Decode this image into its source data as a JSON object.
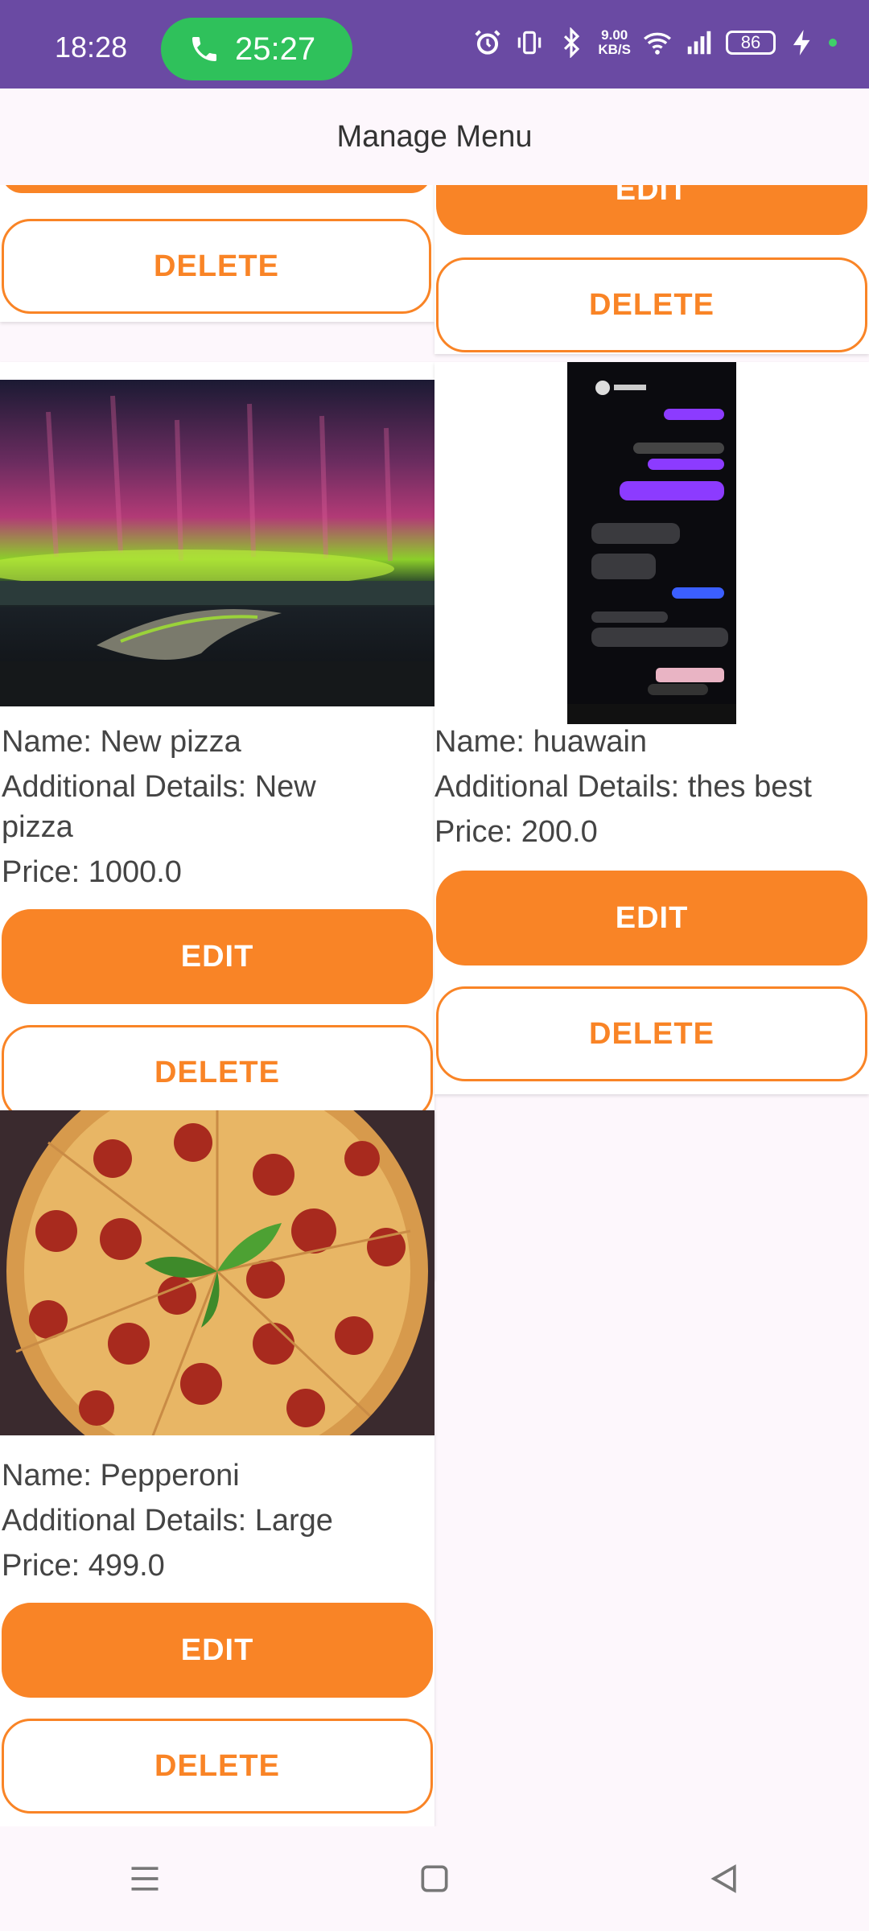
{
  "status_bar": {
    "time": "18:28",
    "call_duration": "25:27",
    "net_speed_value": "9.00",
    "net_speed_unit": "KB/S",
    "battery": "86"
  },
  "app_bar": {
    "title": "Manage Menu"
  },
  "top_partial": {
    "left_delete": "DELETE",
    "right_edit": "EDIT",
    "right_delete": "DELETE"
  },
  "items": [
    {
      "name": "Name: New pizza",
      "details_line1": "Additional Details: New",
      "details_line2": "pizza",
      "price": "Price: 1000.0",
      "edit_label": "EDIT",
      "delete_label": "DELETE",
      "image": "aurora-photo"
    },
    {
      "name": "Name: huawain",
      "details_line1": "Additional Details: thes best",
      "price": "Price: 200.0",
      "edit_label": "EDIT",
      "delete_label": "DELETE",
      "image": "chat-screenshot"
    },
    {
      "name": "Name: Pepperoni",
      "details_line1": "Additional Details: Large",
      "price": "Price: 499.0",
      "edit_label": "EDIT",
      "delete_label": "DELETE",
      "image": "pepperoni-pizza-photo"
    }
  ],
  "colors": {
    "accent": "#f98426",
    "status_bar": "#6a4aa3",
    "call_green": "#2fc15b"
  },
  "nav": {
    "icons": [
      "menu-icon",
      "home-square-icon",
      "back-triangle-icon"
    ]
  }
}
